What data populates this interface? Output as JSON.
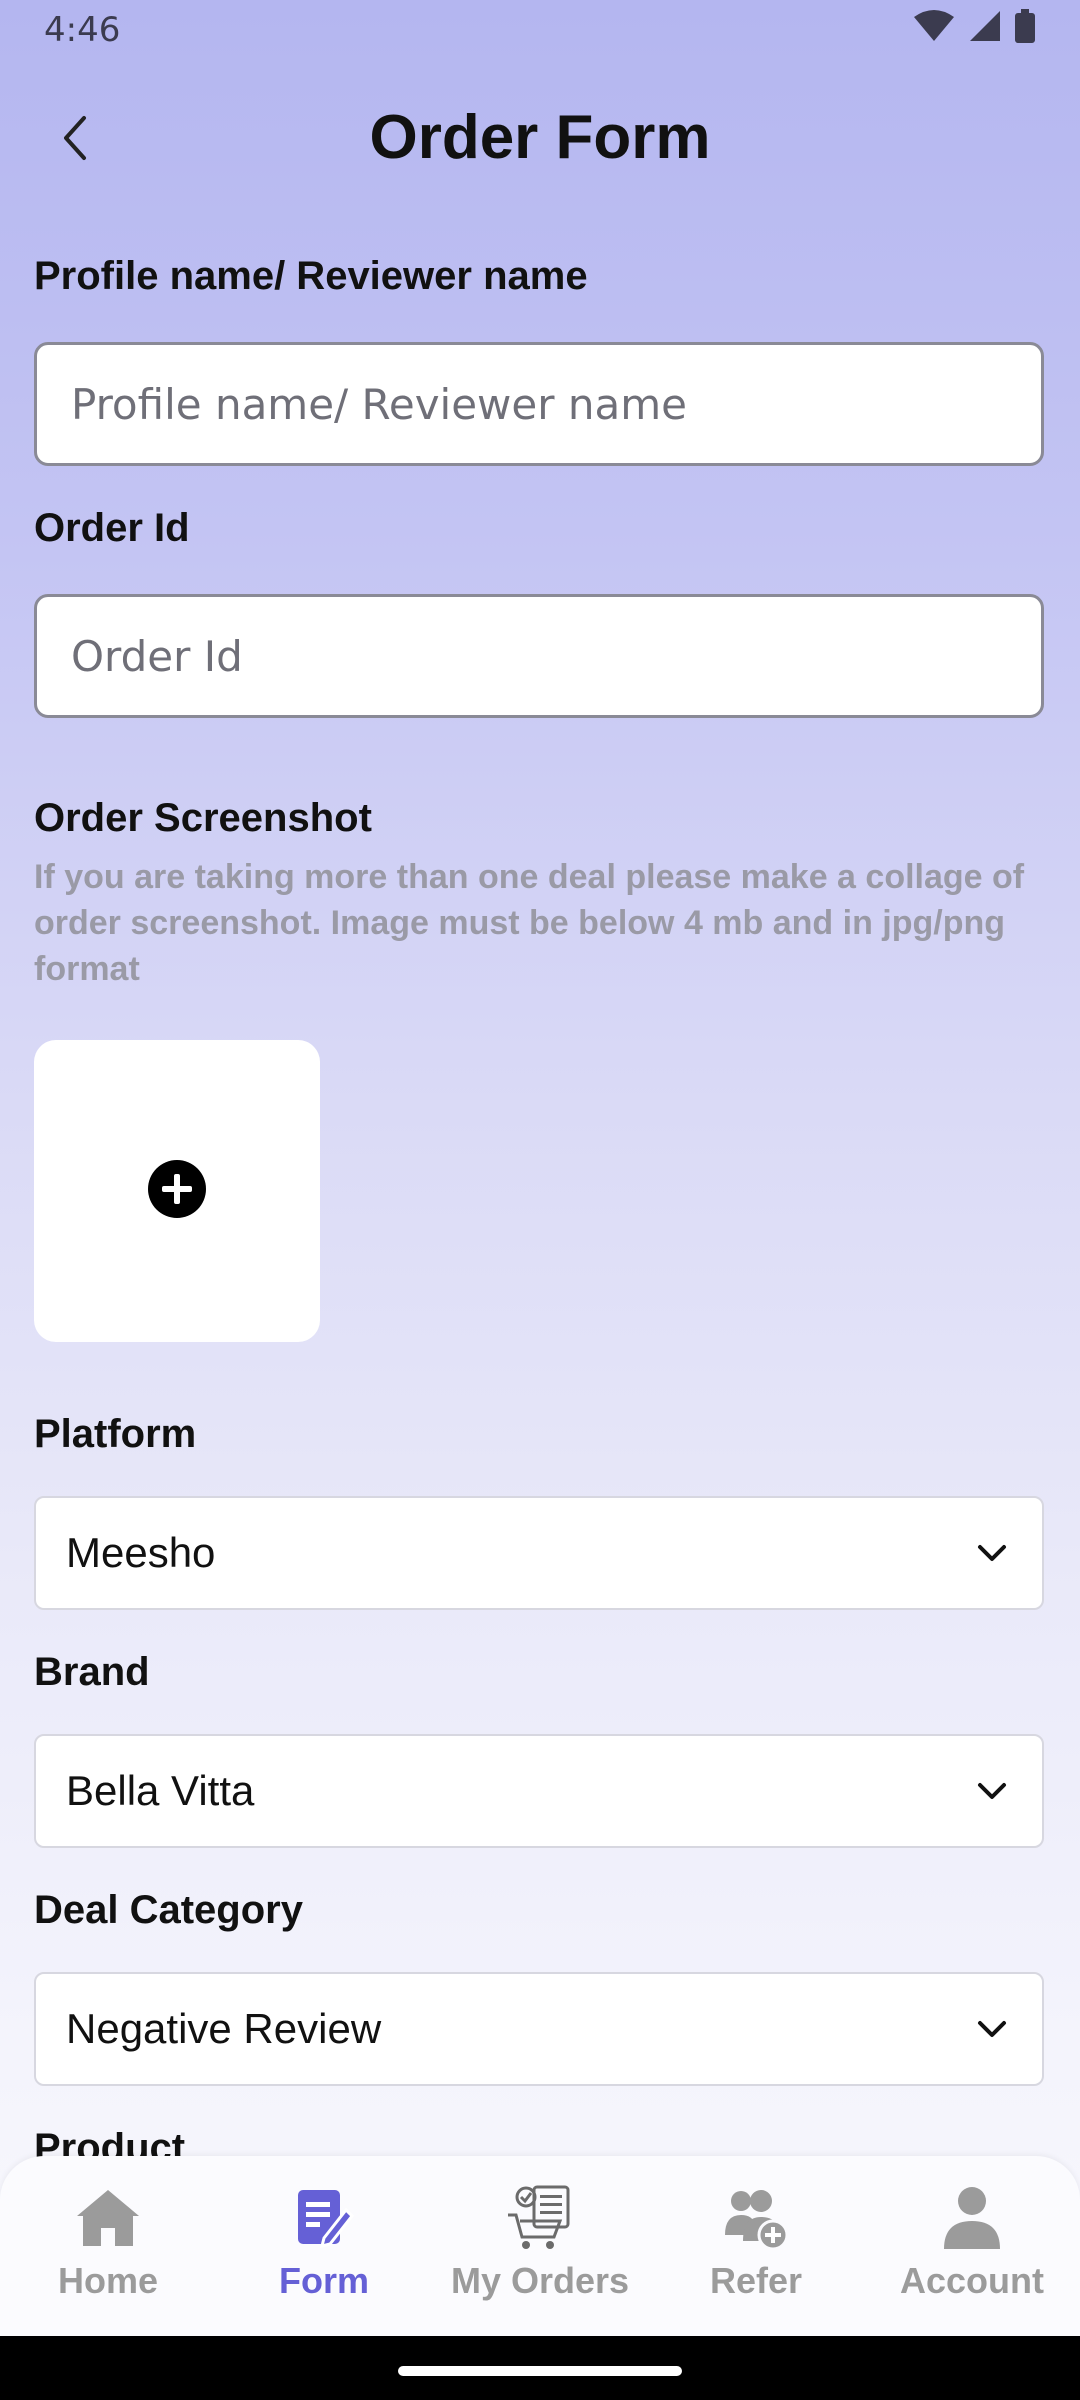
{
  "status_bar": {
    "time": "4:46",
    "icons": [
      "wifi-icon",
      "signal-icon",
      "battery-icon"
    ]
  },
  "header": {
    "back_icon": "chevron-left-icon",
    "title": "Order Form"
  },
  "form": {
    "profile_name": {
      "label": "Profile name/ Reviewer name",
      "placeholder": "Profile name/ Reviewer name",
      "value": ""
    },
    "order_id": {
      "label": "Order Id",
      "placeholder": "Order Id",
      "value": ""
    },
    "order_screenshot": {
      "label": "Order Screenshot",
      "helper": "If you are taking more than one deal please make a collage of order screenshot. Image must be below 4 mb and in jpg/png format",
      "add_icon": "plus-circle-icon"
    },
    "platform": {
      "label": "Platform",
      "selected": "Meesho"
    },
    "brand": {
      "label": "Brand",
      "selected": "Bella Vitta"
    },
    "deal_category": {
      "label": "Deal Category",
      "selected": "Negative Review"
    },
    "product": {
      "label": "Product"
    }
  },
  "bottom_nav": {
    "items": [
      {
        "label": "Home",
        "icon": "home-icon",
        "active": false
      },
      {
        "label": "Form",
        "icon": "form-edit-icon",
        "active": true
      },
      {
        "label": "My Orders",
        "icon": "cart-orders-icon",
        "active": false
      },
      {
        "label": "Refer",
        "icon": "refer-user-icon",
        "active": false
      },
      {
        "label": "Account",
        "icon": "account-icon",
        "active": false
      }
    ],
    "active_color": "#6560d6",
    "inactive_color": "#9b9b9b"
  },
  "colors": {
    "background_top": "#b4b6f0",
    "background_bottom": "#f8f8fd",
    "accent": "#6560d6"
  }
}
